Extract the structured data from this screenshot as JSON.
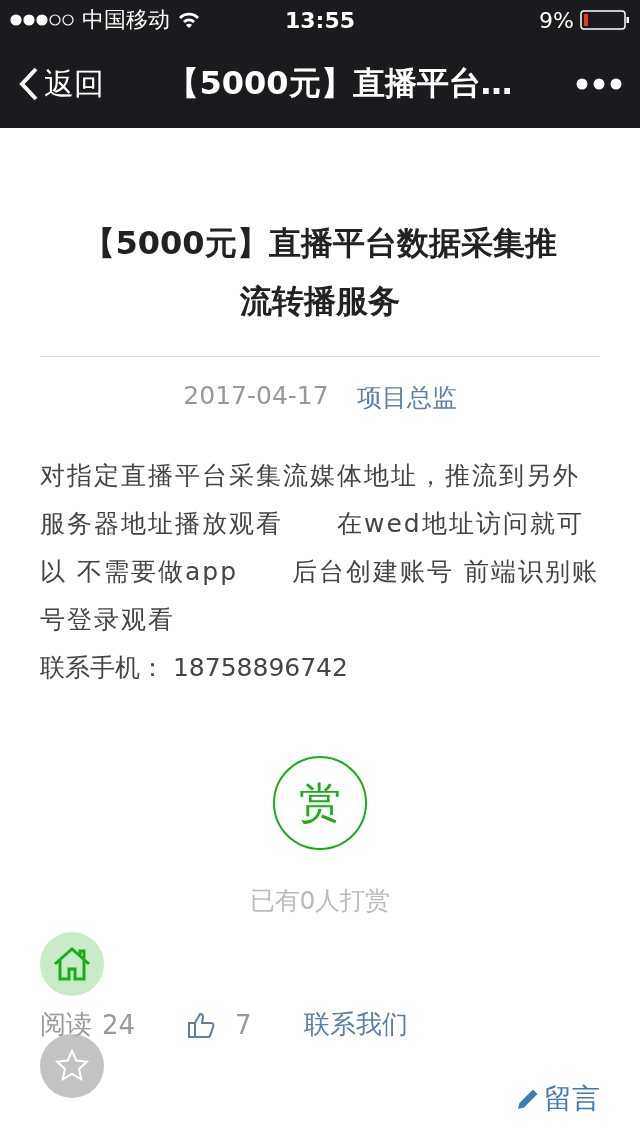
{
  "status_bar": {
    "carrier": "中国移动",
    "time": "13:55",
    "battery": "9%"
  },
  "nav": {
    "back": "返回",
    "title": "【5000元】直播平台…"
  },
  "article": {
    "title": "【5000元】直播平台数据采集推流转播服务",
    "date": "2017-04-17",
    "author": "项目总监",
    "body": "对指定直播平台采集流媒体地址，推流到另外服务器地址播放观看　　在wed地址访问就可以  不需要做app　　后台创建账号  前端识别账号登录观看",
    "contact": "联系手机：  18758896742"
  },
  "reward": {
    "button": "赏",
    "count": "已有0人打赏"
  },
  "footer": {
    "reads_label": "阅读",
    "reads": "24",
    "likes": "7",
    "contact_link": "联系我们",
    "comment": "留言"
  }
}
